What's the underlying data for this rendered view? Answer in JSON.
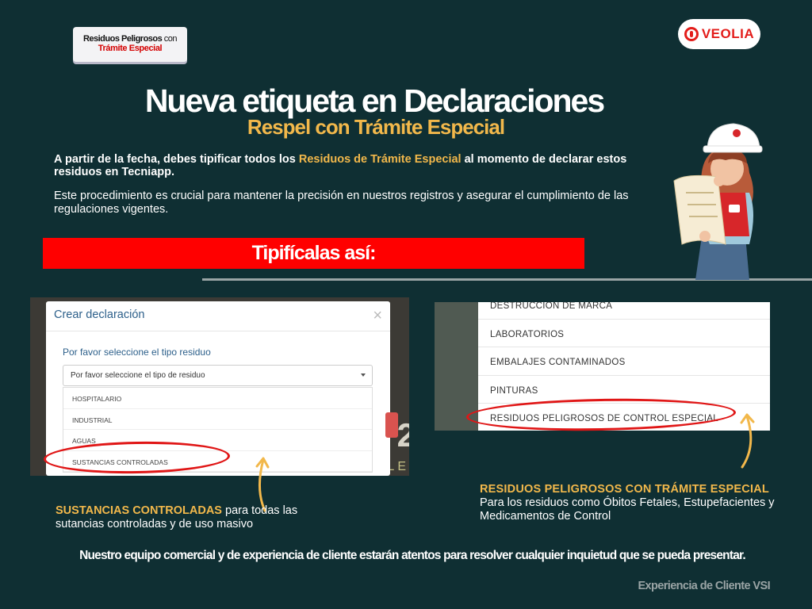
{
  "badge": {
    "line1_bold": "Residuos Peligrosos",
    "line1_normal": " con",
    "line2": "Trámite Especial"
  },
  "logo": {
    "text": "VEOLIA"
  },
  "title": "Nueva etiqueta en Declaraciones",
  "subtitle": "Respel con Trámite Especial",
  "intro": {
    "before": "A partir de la fecha, debes tipificar todos los ",
    "highlight": "Residuos de Trámite Especial",
    "after": " al momento de declarar estos residuos en Tecniapp."
  },
  "paragraph2": "Este procedimiento es crucial para mantener la precisión en nuestros registros y asegurar el cumplimiento de las regulaciones vigentes.",
  "banner": "Tipifícalas así:",
  "screenshot1": {
    "modal_title": "Crear declaración",
    "close": "×",
    "label": "Por favor seleccione el tipo residuo",
    "select_value": "Por favor seleccione el tipo de residuo",
    "options": [
      "HOSPITALARIO",
      "INDUSTRIAL",
      "AGUAS",
      "SUSTANCIAS CONTROLADAS"
    ],
    "bg_text": "2",
    "bg_text2": "ALE"
  },
  "screenshot2": {
    "items": [
      "DESTRUCCION DE MARCA",
      "LABORATORIOS",
      "EMBALAJES CONTAMINADOS",
      "PINTURAS",
      "RESIDUOS PELIGROSOS DE CONTROL ESPECIAL"
    ]
  },
  "caption1": {
    "bold": "SUSTANCIAS CONTROLADAS",
    "rest": " para todas las sutancias controladas y de uso masivo"
  },
  "caption2": {
    "bold": "RESIDUOS PELIGROSOS CON TRÁMITE ESPECIAL",
    "rest": "Para los residuos como Óbitos Fetales, Estupefacientes y Medicamentos de Control"
  },
  "footer": "Nuestro equipo comercial y de experiencia de cliente estarán atentos para resolver cualquier inquietud que se pueda presentar.",
  "signature": "Experiencia de Cliente VSI",
  "colors": {
    "background": "#0f2f33",
    "accent": "#f2b84b",
    "banner": "#ff0000",
    "brand": "#e31d1a"
  }
}
